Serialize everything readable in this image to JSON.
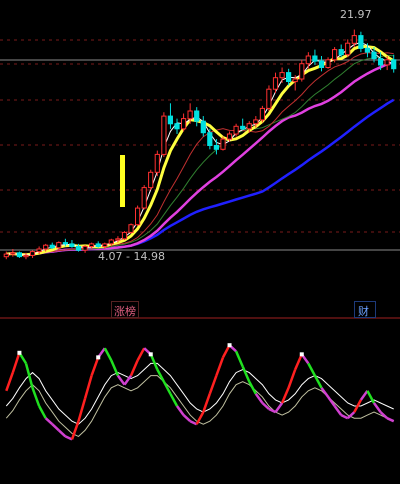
{
  "chart_data": {
    "type": "candlestick",
    "annotations": {
      "high_label": "21.97",
      "low_label": "4.07 - 14.98"
    },
    "bottom_tags": [
      "涨榜",
      "财"
    ],
    "colors": {
      "up": "#ff3030",
      "down": "#00e0e0",
      "ma_yellow": "#ffff40",
      "ma_magenta": "#e040e0",
      "ma_blue": "#2020ff",
      "ma_red": "#c03030",
      "ma_green": "#308030",
      "ma_white": "#ffffff",
      "ind_red": "#ff2020",
      "ind_green": "#20e020",
      "ind_magenta": "#d040d0",
      "grid": "#7a1a1a"
    },
    "candles": [
      [
        4.2,
        4.6,
        4.0,
        4.4
      ],
      [
        4.4,
        4.8,
        4.2,
        4.5
      ],
      [
        4.5,
        4.6,
        4.1,
        4.2
      ],
      [
        4.2,
        4.5,
        4.0,
        4.3
      ],
      [
        4.3,
        4.7,
        4.1,
        4.6
      ],
      [
        4.6,
        5.0,
        4.4,
        4.8
      ],
      [
        4.8,
        5.2,
        4.6,
        5.1
      ],
      [
        5.1,
        5.3,
        4.8,
        4.9
      ],
      [
        4.9,
        5.4,
        4.7,
        5.3
      ],
      [
        5.3,
        5.6,
        5.0,
        5.2
      ],
      [
        5.2,
        5.5,
        4.9,
        5.0
      ],
      [
        5.0,
        5.2,
        4.6,
        4.7
      ],
      [
        4.7,
        5.1,
        4.5,
        5.0
      ],
      [
        5.0,
        5.3,
        4.8,
        5.2
      ],
      [
        5.2,
        5.4,
        4.9,
        5.0
      ],
      [
        5.0,
        5.3,
        4.8,
        5.2
      ],
      [
        5.2,
        5.6,
        5.0,
        5.5
      ],
      [
        5.5,
        5.8,
        5.3,
        5.6
      ],
      [
        5.6,
        6.2,
        5.5,
        6.1
      ],
      [
        6.1,
        6.8,
        6.0,
        6.7
      ],
      [
        6.7,
        8.2,
        6.6,
        8.0
      ],
      [
        8.0,
        9.8,
        7.9,
        9.6
      ],
      [
        9.6,
        11.0,
        9.4,
        10.8
      ],
      [
        10.8,
        12.5,
        10.5,
        12.2
      ],
      [
        12.2,
        15.5,
        12.0,
        15.2
      ],
      [
        15.2,
        16.2,
        14.2,
        14.6
      ],
      [
        14.6,
        15.0,
        13.8,
        14.2
      ],
      [
        14.2,
        15.4,
        14.0,
        15.0
      ],
      [
        15.0,
        16.2,
        14.6,
        15.6
      ],
      [
        15.6,
        15.9,
        14.4,
        14.8
      ],
      [
        14.8,
        15.2,
        13.6,
        13.9
      ],
      [
        13.9,
        14.2,
        12.6,
        12.9
      ],
      [
        12.9,
        13.4,
        12.2,
        12.6
      ],
      [
        12.6,
        13.6,
        12.5,
        13.4
      ],
      [
        13.4,
        14.0,
        13.2,
        13.8
      ],
      [
        13.8,
        14.6,
        13.6,
        14.4
      ],
      [
        14.4,
        15.0,
        14.1,
        14.2
      ],
      [
        14.2,
        14.8,
        13.9,
        14.6
      ],
      [
        14.6,
        15.2,
        14.3,
        14.9
      ],
      [
        14.9,
        16.0,
        14.7,
        15.8
      ],
      [
        15.8,
        17.6,
        15.6,
        17.3
      ],
      [
        17.3,
        18.6,
        17.0,
        18.2
      ],
      [
        18.2,
        19.0,
        17.8,
        18.6
      ],
      [
        18.6,
        18.9,
        17.6,
        17.9
      ],
      [
        17.9,
        18.4,
        17.2,
        18.1
      ],
      [
        18.1,
        19.6,
        17.9,
        19.3
      ],
      [
        19.3,
        20.2,
        18.9,
        19.9
      ],
      [
        19.9,
        20.4,
        19.2,
        19.5
      ],
      [
        19.5,
        19.9,
        18.7,
        19.0
      ],
      [
        19.0,
        19.8,
        18.9,
        19.6
      ],
      [
        19.6,
        20.6,
        19.4,
        20.4
      ],
      [
        20.4,
        20.8,
        19.8,
        20.0
      ],
      [
        20.0,
        21.2,
        19.8,
        20.9
      ],
      [
        20.9,
        21.97,
        20.6,
        21.5
      ],
      [
        21.5,
        21.8,
        20.2,
        20.5
      ],
      [
        20.5,
        20.9,
        19.8,
        20.2
      ],
      [
        20.2,
        20.6,
        19.4,
        19.7
      ],
      [
        19.7,
        20.2,
        18.8,
        19.2
      ],
      [
        19.2,
        19.9,
        18.8,
        19.6
      ],
      [
        19.6,
        20.0,
        18.6,
        18.9
      ]
    ],
    "indicator": {
      "k": [
        60,
        72,
        85,
        78,
        62,
        50,
        42,
        38,
        34,
        30,
        28,
        40,
        55,
        70,
        82,
        88,
        80,
        70,
        64,
        70,
        80,
        88,
        84,
        74,
        66,
        58,
        50,
        44,
        40,
        38,
        46,
        58,
        70,
        82,
        90,
        86,
        76,
        66,
        58,
        52,
        48,
        46,
        52,
        62,
        74,
        84,
        78,
        70,
        62,
        56,
        50,
        44,
        42,
        46,
        54,
        60,
        52,
        46,
        42,
        40
      ],
      "d": [
        50,
        55,
        62,
        68,
        72,
        68,
        60,
        54,
        48,
        44,
        40,
        38,
        42,
        48,
        56,
        64,
        70,
        72,
        70,
        68,
        70,
        74,
        78,
        78,
        74,
        70,
        64,
        58,
        52,
        48,
        46,
        48,
        52,
        58,
        66,
        72,
        74,
        72,
        68,
        64,
        58,
        54,
        52,
        54,
        58,
        64,
        68,
        70,
        68,
        64,
        60,
        56,
        52,
        50,
        50,
        52,
        54,
        52,
        50,
        48
      ]
    }
  }
}
